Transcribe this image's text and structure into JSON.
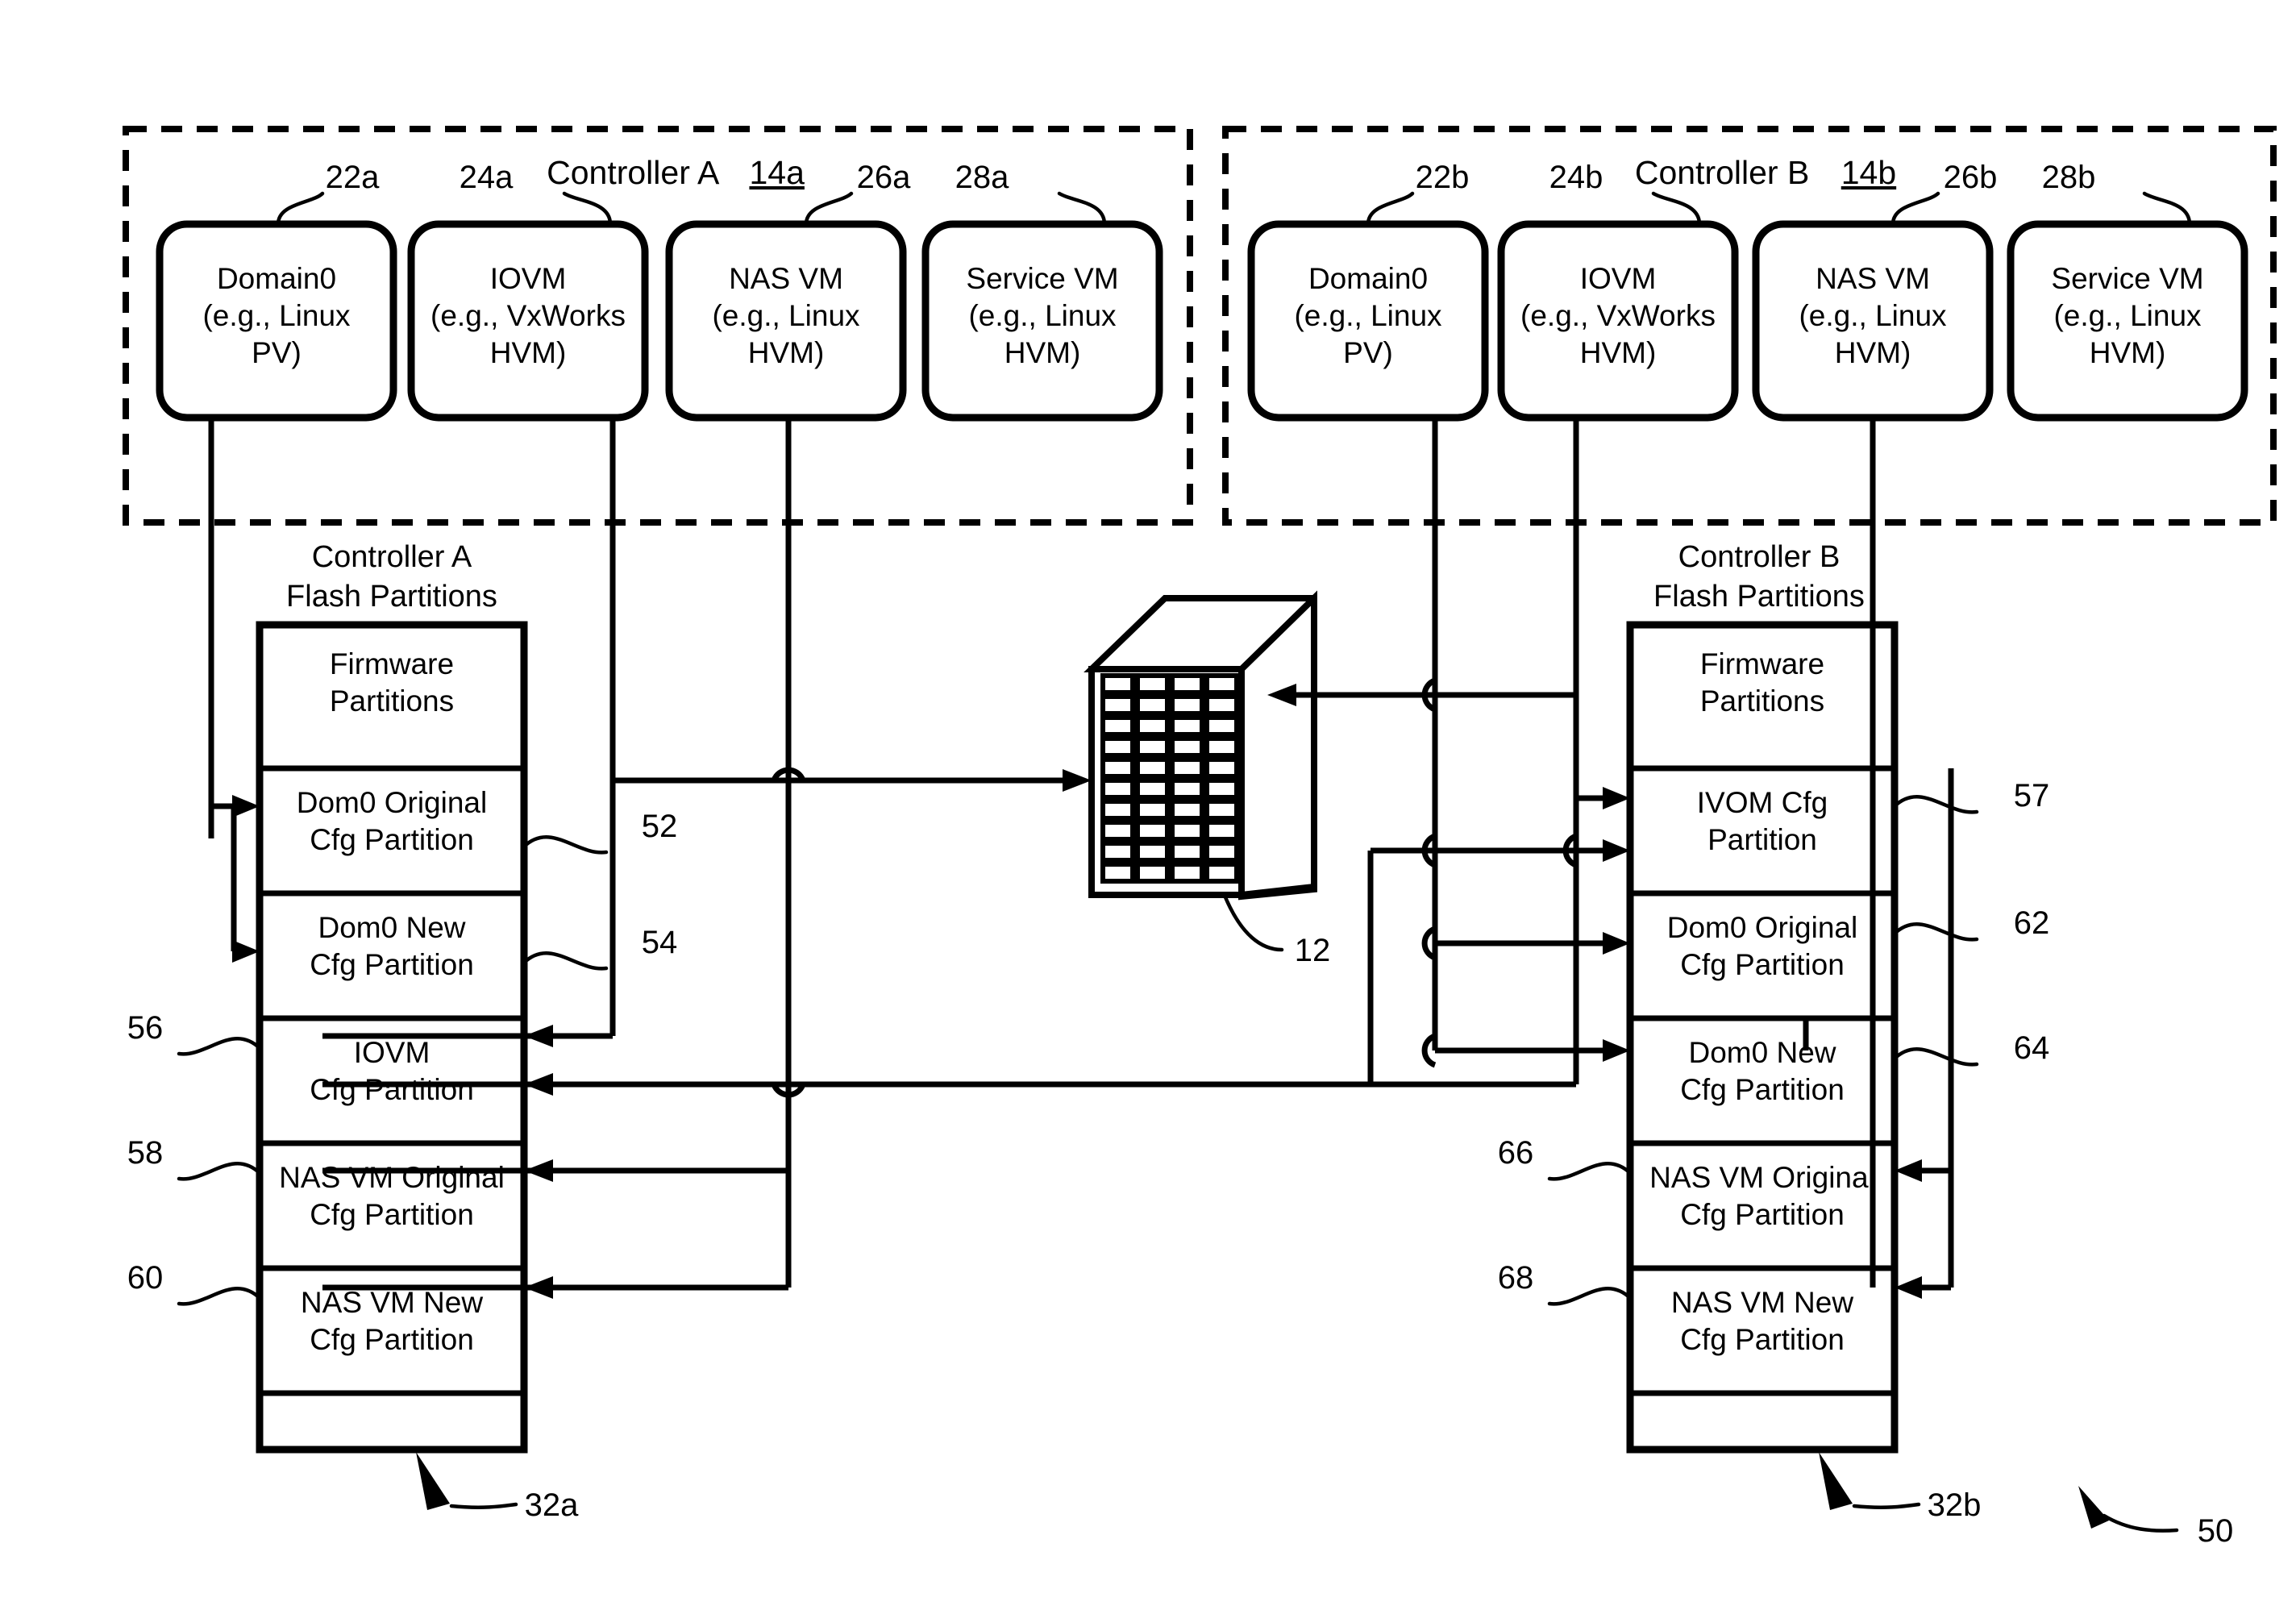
{
  "figure": {
    "reference_numeral": "50",
    "storage_array_ref": "12"
  },
  "controllers": [
    {
      "id": "a",
      "title": "Controller A",
      "title_ref": "14a",
      "flash_title_line1": "Controller A",
      "flash_title_line2": "Flash Partitions",
      "flash_ref": "32a",
      "vms": [
        {
          "ref": "22a",
          "line1": "Domain0",
          "line2": "(e.g., Linux",
          "line3": "PV)"
        },
        {
          "ref": "24a",
          "line1": "IOVM",
          "line2": "(e.g., VxWorks",
          "line3": "HVM)"
        },
        {
          "ref": "26a",
          "line1": "NAS VM",
          "line2": "(e.g., Linux",
          "line3": "HVM)"
        },
        {
          "ref": "28a",
          "line1": "Service VM",
          "line2": "(e.g., Linux",
          "line3": "HVM)"
        }
      ],
      "partitions": [
        {
          "ref": "",
          "line1": "Firmware",
          "line2": "Partitions"
        },
        {
          "ref": "52",
          "line1": "Dom0 Original",
          "line2": "Cfg Partition"
        },
        {
          "ref": "54",
          "line1": "Dom0 New",
          "line2": "Cfg Partition"
        },
        {
          "ref": "56",
          "line1": "IOVM",
          "line2": "Cfg Partition"
        },
        {
          "ref": "58",
          "line1": "NAS VM Original",
          "line2": "Cfg Partition"
        },
        {
          "ref": "60",
          "line1": "NAS VM New",
          "line2": "Cfg Partition"
        },
        {
          "ref": "",
          "line1": "",
          "line2": ""
        }
      ]
    },
    {
      "id": "b",
      "title": "Controller B",
      "title_ref": "14b",
      "flash_title_line1": "Controller B",
      "flash_title_line2": "Flash Partitions",
      "flash_ref": "32b",
      "vms": [
        {
          "ref": "22b",
          "line1": "Domain0",
          "line2": "(e.g., Linux",
          "line3": "PV)"
        },
        {
          "ref": "24b",
          "line1": "IOVM",
          "line2": "(e.g., VxWorks",
          "line3": "HVM)"
        },
        {
          "ref": "26b",
          "line1": "NAS VM",
          "line2": "(e.g., Linux",
          "line3": "HVM)"
        },
        {
          "ref": "28b",
          "line1": "Service VM",
          "line2": "(e.g., Linux",
          "line3": "HVM)"
        }
      ],
      "partitions": [
        {
          "ref": "",
          "line1": "Firmware",
          "line2": "Partitions"
        },
        {
          "ref": "57",
          "line1": "IVOM Cfg",
          "line2": "Partition"
        },
        {
          "ref": "62",
          "line1": "Dom0 Original",
          "line2": "Cfg Partition"
        },
        {
          "ref": "64",
          "line1": "Dom0 New",
          "line2": "Cfg Partition"
        },
        {
          "ref": "66",
          "line1": "NAS VM Original",
          "line2": "Cfg Partition"
        },
        {
          "ref": "68",
          "line1": "NAS VM New",
          "line2": "Cfg Partition"
        },
        {
          "ref": "",
          "line1": "",
          "line2": ""
        }
      ]
    }
  ],
  "colors": {
    "ink": "#000000",
    "paper": "#ffffff"
  }
}
